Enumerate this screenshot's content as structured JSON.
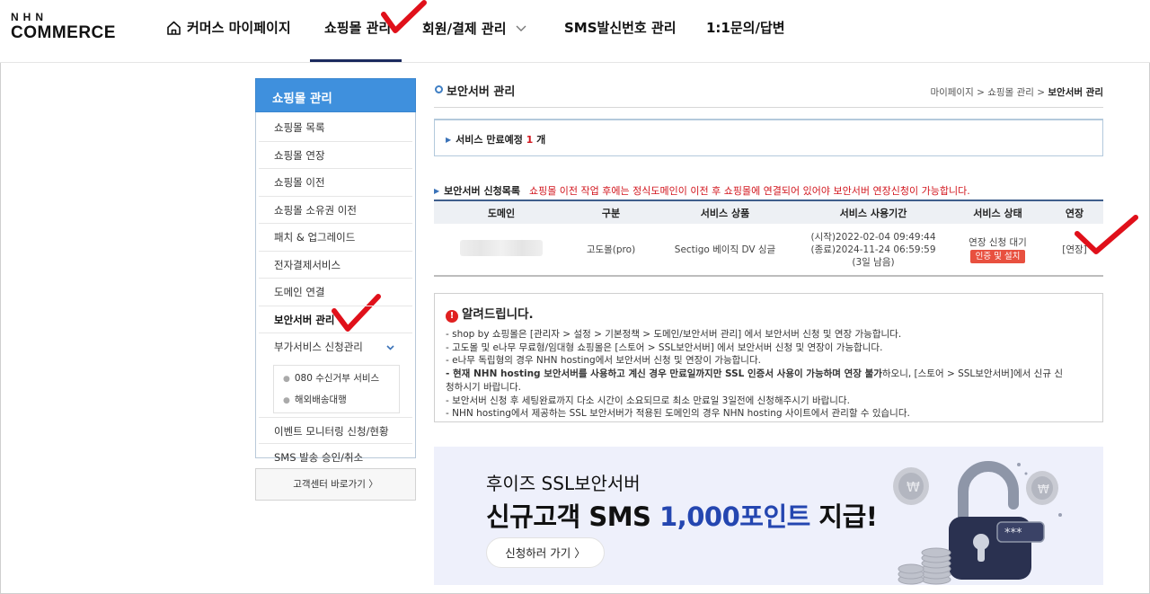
{
  "header": {
    "logo_line1": "NHN",
    "logo_line2": "COMMERCE",
    "nav": [
      {
        "label": "커머스 마이페이지"
      },
      {
        "label": "쇼핑몰 관리"
      },
      {
        "label": "회원/결제 관리"
      },
      {
        "label": "SMS발신번호 관리"
      },
      {
        "label": "1:1문의/답변"
      }
    ]
  },
  "sidebar": {
    "title": "쇼핑몰 관리",
    "items": [
      {
        "label": "쇼핑몰 목록"
      },
      {
        "label": "쇼핑몰 연장"
      },
      {
        "label": "쇼핑몰 이전"
      },
      {
        "label": "쇼핑몰 소유권 이전"
      },
      {
        "label": "패치 & 업그레이드"
      },
      {
        "label": "전자결제서비스"
      },
      {
        "label": "도메인 연결"
      },
      {
        "label": "보안서버 관리"
      },
      {
        "label": "부가서비스 신청관리"
      }
    ],
    "sub_items": [
      {
        "label": "080 수신거부 서비스"
      },
      {
        "label": "해외배송대행"
      }
    ],
    "bottom_items": [
      {
        "label": "이벤트 모니터링 신청/현황"
      },
      {
        "label": "SMS 발송 승인/취소"
      }
    ],
    "cs_button": "고객센터 바로가기 〉"
  },
  "main": {
    "title": "보안서버 관리",
    "breadcrumb": {
      "part1": "마이페이지",
      "sep": " > ",
      "part2": "쇼핑몰 관리",
      "current": "보안서버 관리"
    },
    "expiry": {
      "prefix": "서비스 만료예정",
      "count": "1",
      "suffix": "개"
    },
    "list_label": "보안서버 신청목록",
    "list_warning": "쇼핑몰 이전 작업 후에는 정식도메인이 이전 후 쇼핑몰에 연결되어 있어야 보안서버 연장신청이 가능합니다.",
    "table": {
      "headers": [
        "도메인",
        "구분",
        "서비스 상품",
        "서비스 사용기간",
        "서비스 상태",
        "연장"
      ],
      "rows": [
        {
          "domain": "",
          "type": "고도몰(pro)",
          "product": "Sectigo 베이직 DV 싱글",
          "period_start": "(시작)2022-02-04 09:49:44",
          "period_end": "(종료)2024-11-24 06:59:59",
          "period_left": "(3일 남음)",
          "status": "연장 신청 대기",
          "status_badge": "인증 및 설치",
          "extend": "[연장]"
        }
      ]
    },
    "notice": {
      "title": "알려드립니다.",
      "lines": [
        "- shop by 쇼핑몰은 [관리자 > 설정 > 기본정책 > 도메인/보안서버 관리] 에서 보안서버 신청 및 연장 가능합니다.",
        "- 고도몰 및 e나무 무료형/임대형 쇼핑몰은 [스토어 > SSL보안서버] 에서 보안서버 신청 및 연장이 가능합니다.",
        "- e나무 독립형의 경우 NHN hosting에서 보안서버 신청 및 연장이 가능합니다."
      ],
      "bold_line_bold": "- 현재 NHN hosting 보안서버를 사용하고 계신 경우 만료일까지만 SSL 인증서 사용이 가능하며 연장 불가",
      "bold_line_rest": "하오니, [스토어 > SSL보안서버]에서 신규 신",
      "bold_line_cont": "청하시기 바랍니다.",
      "tail_lines": [
        "- 보안서버 신청 후 세팅완료까지 다소 시간이 소요되므로 최소 만료일 3일전에 신청해주시기 바랍니다.",
        "- NHN hosting에서 제공하는 SSL 보안서버가 적용된 도메인의 경우 NHN hosting 사이트에서 관리할 수 있습니다."
      ]
    },
    "banner": {
      "subtitle": "후이즈 SSL보안서버",
      "headline_a": "신규고객 SMS ",
      "headline_hl": "1,000포인트",
      "headline_b": " 지급!",
      "button": "신청하러 가기 〉",
      "accent_color": "#2446b0"
    }
  },
  "colors": {
    "sidebar_head": "#3f90dd",
    "active_nav_bar": "#1b2a5e",
    "warning_red": "#d2161e",
    "badge_red": "#e8503f",
    "check_red": "#e0101a"
  }
}
